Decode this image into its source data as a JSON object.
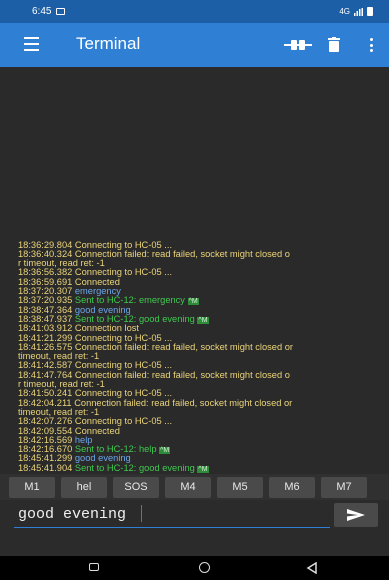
{
  "status_bar": {
    "time": "6:45",
    "network": "4G"
  },
  "app_bar": {
    "title": "Terminal"
  },
  "terminal": {
    "lines": [
      {
        "ts": "18:36:29.804",
        "text": "Connecting to HC-05 ...",
        "kind": "sys"
      },
      {
        "ts": "18:36:40.324",
        "text": "Connection failed: read failed, socket might closed o",
        "kind": "sys"
      },
      {
        "ts": "",
        "text": "r timeout, read ret: -1",
        "kind": "sys"
      },
      {
        "ts": "18:36:56.382",
        "text": "Connecting to HC-05 ...",
        "kind": "sys"
      },
      {
        "ts": "18:36:59.691",
        "text": "Connected",
        "kind": "sys"
      },
      {
        "ts": "18:37:20.307",
        "text": "emergency",
        "kind": "recv"
      },
      {
        "ts": "18:37:20.935",
        "text": "Sent to HC-12: emergency",
        "kind": "sent",
        "marker": "^M"
      },
      {
        "ts": "18:38:47.364",
        "text": "good evening",
        "kind": "recv"
      },
      {
        "ts": "18:38:47.937",
        "text": "Sent to HC-12: good evening",
        "kind": "sent",
        "marker": "^M"
      },
      {
        "ts": "18:41:03.912",
        "text": "Connection lost",
        "kind": "sys"
      },
      {
        "ts": "18:41:21.299",
        "text": "Connecting to HC-05 ...",
        "kind": "sys"
      },
      {
        "ts": "18:41:26.575",
        "text": "Connection failed: read failed, socket might closed or",
        "kind": "sys"
      },
      {
        "ts": "",
        "text": "timeout, read ret: -1",
        "kind": "sys"
      },
      {
        "ts": "18:41:42.587",
        "text": "Connecting to HC-05 ...",
        "kind": "sys"
      },
      {
        "ts": "18:41:47.764",
        "text": "Connection failed: read failed, socket might closed o",
        "kind": "sys"
      },
      {
        "ts": "",
        "text": "r timeout, read ret: -1",
        "kind": "sys"
      },
      {
        "ts": "18:41:50.241",
        "text": "Connecting to HC-05 ...",
        "kind": "sys"
      },
      {
        "ts": "18:42:04.211",
        "text": "Connection failed: read failed, socket might closed or",
        "kind": "sys"
      },
      {
        "ts": "",
        "text": "timeout, read ret: -1",
        "kind": "sys"
      },
      {
        "ts": "18:42:07.276",
        "text": "Connecting to HC-05 ...",
        "kind": "sys"
      },
      {
        "ts": "18:42:09.554",
        "text": "Connected",
        "kind": "sys"
      },
      {
        "ts": "18:42:16.569",
        "text": "help",
        "kind": "recv"
      },
      {
        "ts": "18:42:16.670",
        "text": "Sent to HC-12: help",
        "kind": "sent",
        "marker": "^M"
      },
      {
        "ts": "18:45:41.299",
        "text": "good evening",
        "kind": "recv"
      },
      {
        "ts": "18:45:41.904",
        "text": "Sent to HC-12: good evening",
        "kind": "sent",
        "marker": "^M"
      }
    ]
  },
  "macros": [
    "M1",
    "hel",
    "SOS",
    "M4",
    "M5",
    "M6",
    "M7"
  ],
  "input": {
    "value": "good evening"
  },
  "colors": {
    "status_bar": "#1c5fa6",
    "app_bar": "#2f80d4",
    "terminal_bg": "#2a2a2a",
    "system_text": "#ecd57a",
    "sent_text": "#3fc94f",
    "received_text": "#6aa6ea",
    "macro_button": "#4a4a4a"
  },
  "icons": {
    "menu": "hamburger-icon",
    "connect": "connect-plug-icon",
    "clear": "trash-icon",
    "more": "more-vertical-icon",
    "send": "send-arrow-icon"
  }
}
